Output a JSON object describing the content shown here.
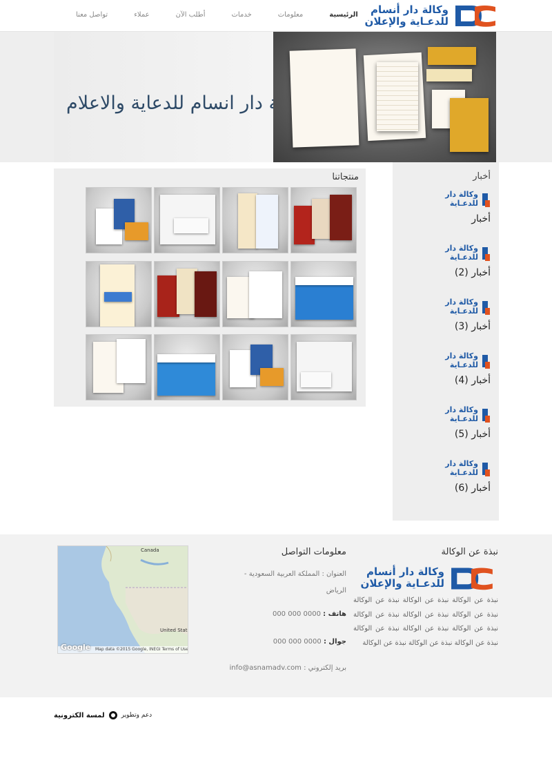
{
  "header": {
    "logo": {
      "line1": "وكالة دار أنسام",
      "line2": "للدعـاية والإعلان",
      "mark": "DG-logo-mark"
    },
    "nav": [
      {
        "label": "الرئيسية",
        "active": true
      },
      {
        "label": "معلومات",
        "active": false
      },
      {
        "label": "خدمات",
        "active": false
      },
      {
        "label": "أطلب الآن",
        "active": false
      },
      {
        "label": "عملاء",
        "active": false
      },
      {
        "label": "تواصل معنا",
        "active": false
      }
    ]
  },
  "hero": {
    "title": "وكالة دار انسام للدعاية والاعلام"
  },
  "products": {
    "title": "منتجاتنا"
  },
  "sidebar": {
    "title": "أخبار",
    "logo_line1": "وكالة دار",
    "logo_line2": "للدعـاية",
    "items": [
      {
        "label": "أخبار"
      },
      {
        "label": "أخبار (2)"
      },
      {
        "label": "أخبار (3)"
      },
      {
        "label": "أخبار (4)"
      },
      {
        "label": "أخبار (5)"
      },
      {
        "label": "أخبار (6)"
      }
    ]
  },
  "footer": {
    "about": {
      "title": "نبذة عن الوكالة",
      "logo_line1": "وكالة دار أنسام",
      "logo_line2": "للدعـاية والإعلان",
      "text": "نبذة عن الوكالة نبذة عن الوكالة نبذة عن الوكالة نبذة عن الوكالة نبذة عن الوكالة نبذة عن الوكالة نبذة عن الوكالة نبذة عن الوكالة نبذة عن الوكالة نبذة عن الوكالة نبذة عن الوكالة نبذة عن الوكالة"
    },
    "contact": {
      "title": "معلومات التواصل",
      "address_label": "العنوان :",
      "address_value": "المملكة العربية السعودية - الرياض",
      "phone_label": "هاتف :",
      "phone_value": "0000 000 000",
      "mobile_label": "جوال :",
      "mobile_value": "0000 000 000",
      "email_label": "بريد إلكتروني :",
      "email_value": "info@asnamadv.com"
    },
    "map": {
      "label_canada": "Canada",
      "label_us": "United States",
      "google": "Google",
      "credit": "Map data ©2015 Google, INEGI   Terms of Use"
    }
  },
  "bottom": {
    "credit_small": "دعم وتطوير",
    "credit_brand": "لمسة الكترونية"
  }
}
